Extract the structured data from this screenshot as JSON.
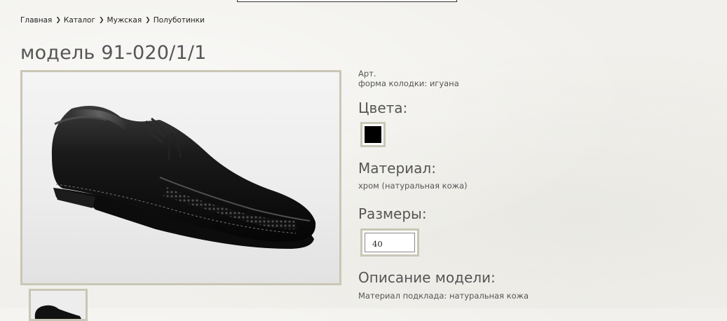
{
  "breadcrumb": {
    "items": [
      "Главная",
      "Каталог",
      "Мужская",
      "Полуботинки"
    ],
    "separator": "❯"
  },
  "page_title": "модель 91-020/1/1",
  "product": {
    "article_label": "Арт.",
    "last_shape": "форма колодки: игуана",
    "colors_heading": "Цвета:",
    "colors": [
      {
        "name": "black",
        "hex": "#000000"
      }
    ],
    "material_heading": "Материал:",
    "material_value": "хром (натуральная кожа)",
    "sizes_heading": "Размеры:",
    "sizes": [
      "40"
    ],
    "description_heading": "Описание модели:",
    "description_text": "Материал подклада: натуральная кожа"
  },
  "images": {
    "main": "shoe-photo",
    "thumbnails": [
      "shoe-thumbnail"
    ]
  },
  "colors": {
    "frame": "#c9c7b5",
    "text": "#555555",
    "background": "#f1f0ec"
  }
}
